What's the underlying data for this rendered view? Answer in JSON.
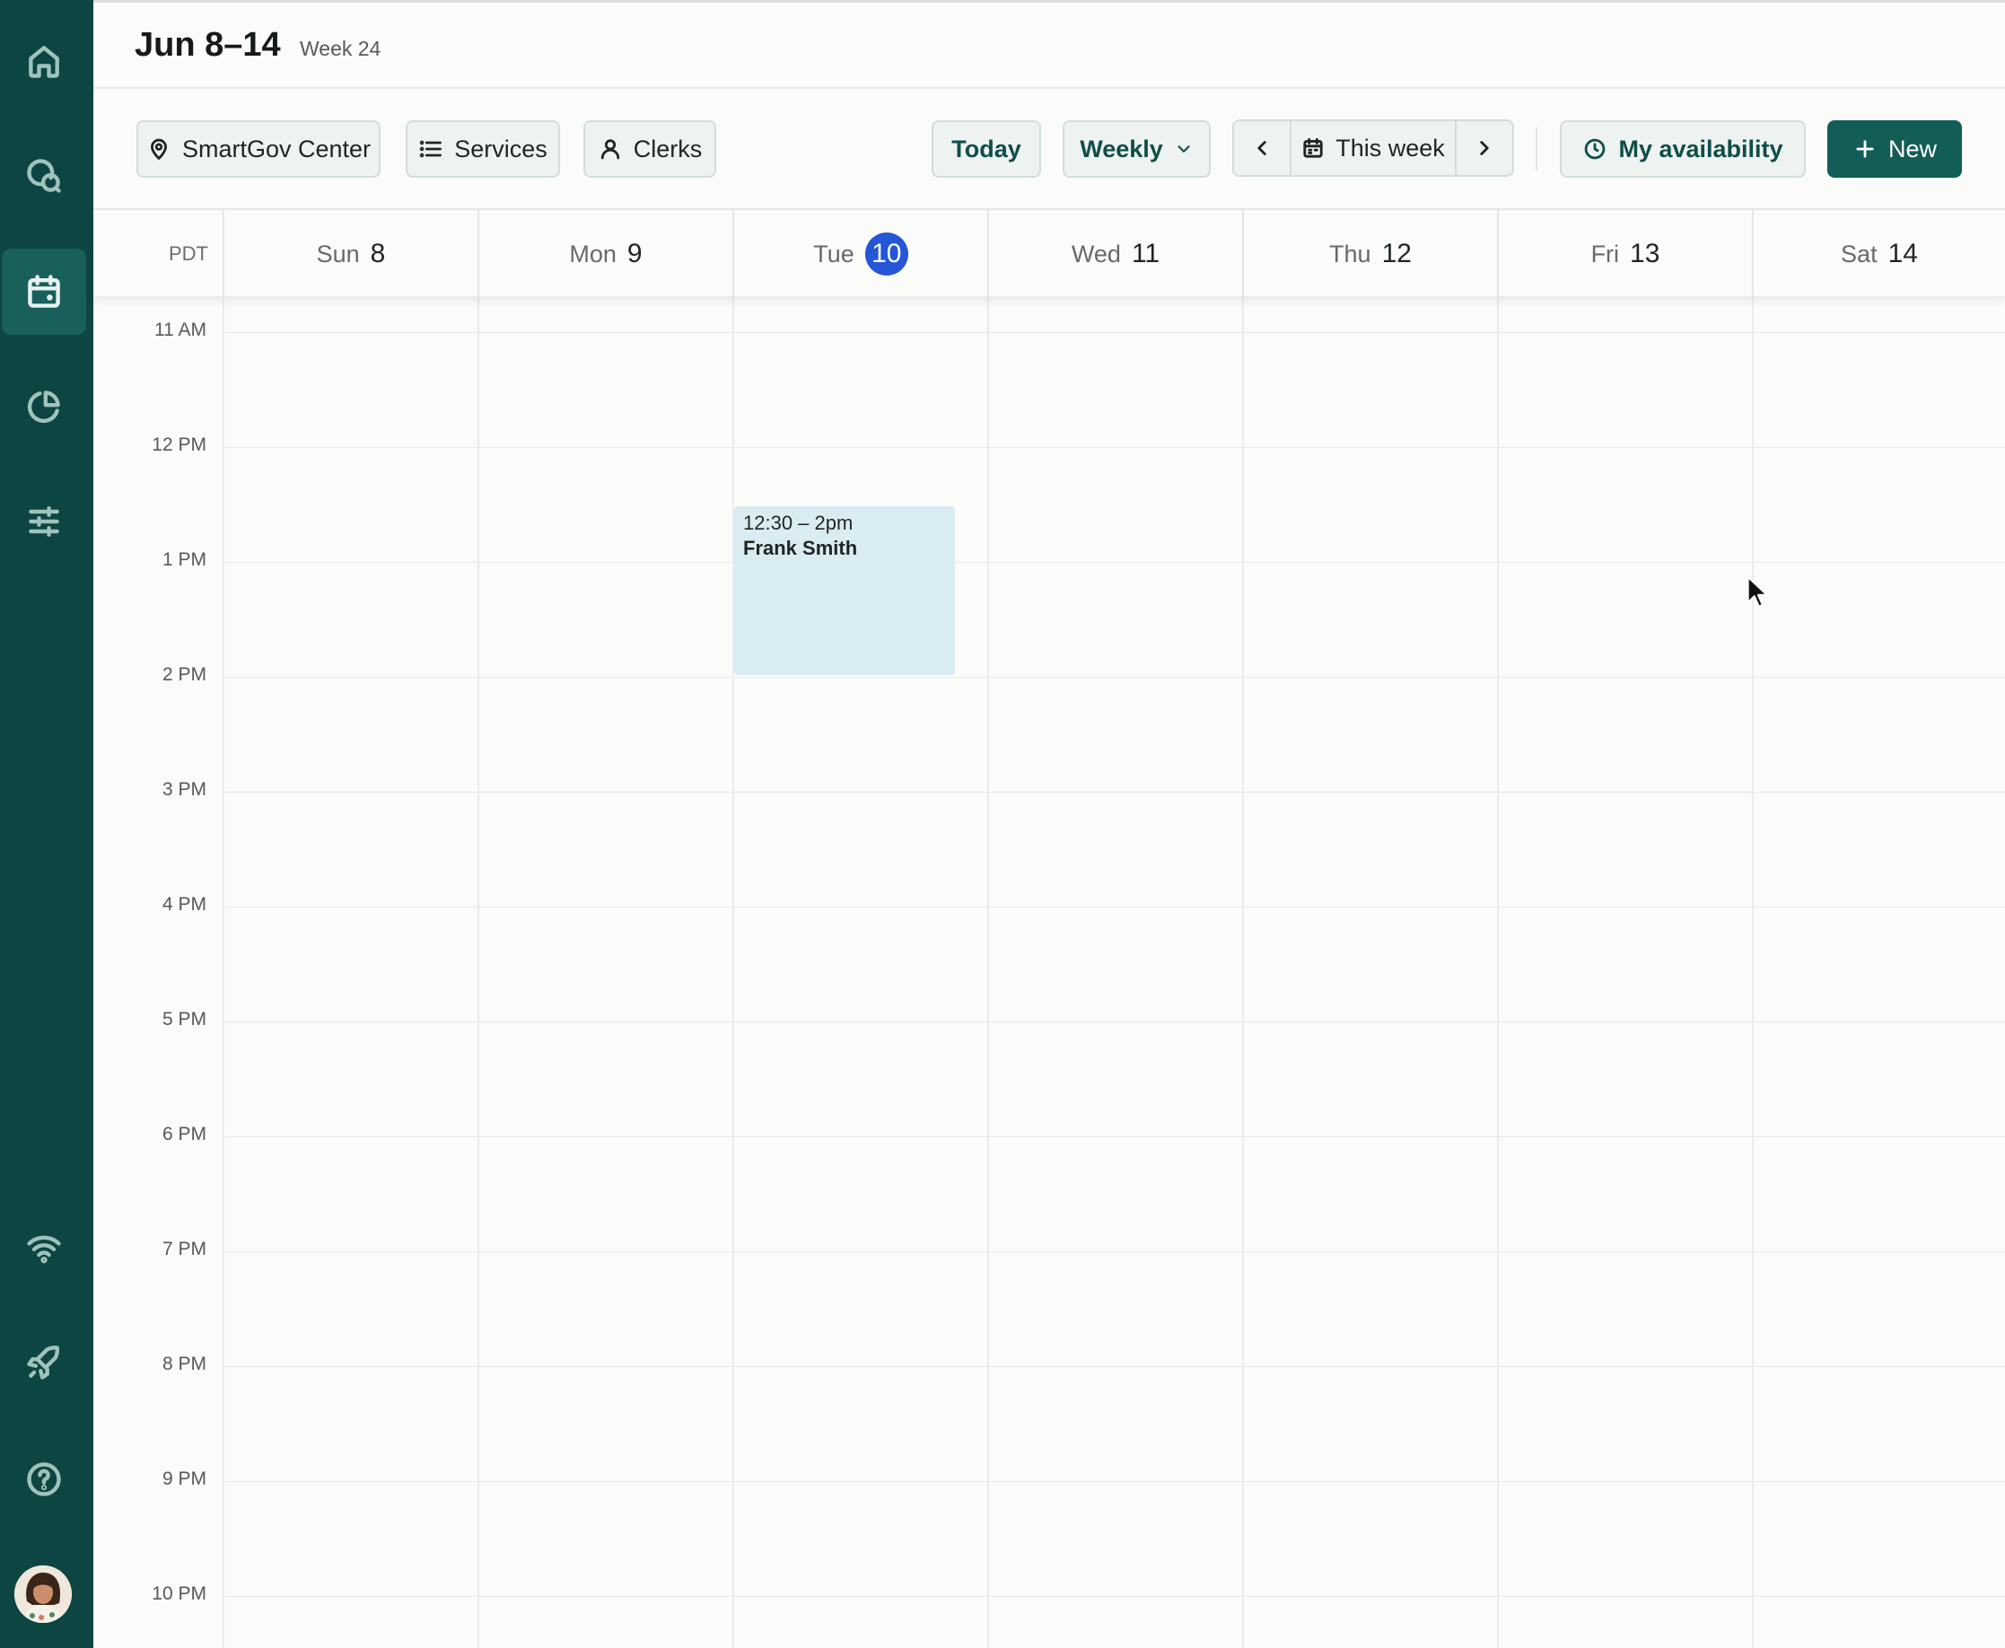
{
  "header": {
    "title": "Jun 8–14",
    "week_label": "Week 24"
  },
  "toolbar": {
    "location_label": "SmartGov Center",
    "services_label": "Services",
    "clerks_label": "Clerks",
    "today_label": "Today",
    "view_label": "Weekly",
    "period_label": "This week",
    "availability_label": "My availability",
    "new_label": "New"
  },
  "sidebar": {
    "items": [
      {
        "icon": "home-icon"
      },
      {
        "icon": "chat-icon"
      },
      {
        "icon": "calendar-icon",
        "active": true
      },
      {
        "icon": "pie-chart-icon"
      },
      {
        "icon": "sliders-icon"
      },
      {
        "icon": "wifi-icon"
      },
      {
        "icon": "rocket-icon"
      },
      {
        "icon": "help-icon"
      }
    ]
  },
  "calendar": {
    "timezone": "PDT",
    "days": [
      {
        "dow": "Sun",
        "num": "8"
      },
      {
        "dow": "Mon",
        "num": "9"
      },
      {
        "dow": "Tue",
        "num": "10",
        "today": true
      },
      {
        "dow": "Wed",
        "num": "11"
      },
      {
        "dow": "Thu",
        "num": "12"
      },
      {
        "dow": "Fri",
        "num": "13"
      },
      {
        "dow": "Sat",
        "num": "14"
      }
    ],
    "hours": [
      "11 AM",
      "12 PM",
      "1 PM",
      "2 PM",
      "3 PM",
      "4 PM",
      "5 PM",
      "6 PM",
      "7 PM",
      "8 PM",
      "9 PM",
      "10 PM"
    ],
    "events": [
      {
        "time": "12:30 – 2pm",
        "title": "Frank Smith",
        "day": "Tue"
      }
    ]
  },
  "colors": {
    "sidebar_bg": "#0c4541",
    "primary": "#135d57",
    "today_badge": "#2456d6",
    "event_bg": "#d9ecf1"
  }
}
